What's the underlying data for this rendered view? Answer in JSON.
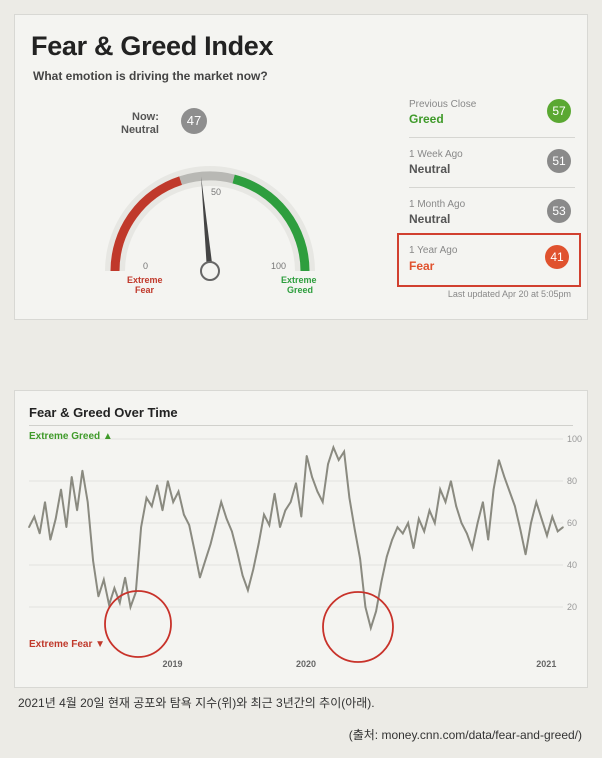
{
  "header": {
    "title": "Fear & Greed Index",
    "subtitle": "What emotion is driving the market now?"
  },
  "gauge": {
    "now_label": "Now:",
    "now_state": "Neutral",
    "now_value": "47",
    "needle_value": 47,
    "tick_0": "0",
    "tick_50": "50",
    "tick_100": "100",
    "left_label_1": "Extreme",
    "left_label_2": "Fear",
    "right_label_1": "Extreme",
    "right_label_2": "Greed",
    "colors": {
      "fear": "#c0392b",
      "greed": "#2e9e3e",
      "neutral": "#8e8e8e"
    }
  },
  "history": [
    {
      "label": "Previous Close",
      "state": "Greed",
      "value": "57",
      "color": "#5aa832",
      "text_color": "#3f9a2a"
    },
    {
      "label": "1 Week Ago",
      "state": "Neutral",
      "value": "51",
      "color": "#8a8a8a",
      "text_color": "#555555"
    },
    {
      "label": "1 Month Ago",
      "state": "Neutral",
      "value": "53",
      "color": "#8a8a8a",
      "text_color": "#555555"
    },
    {
      "label": "1 Year Ago",
      "state": "Fear",
      "value": "41",
      "color": "#e0522e",
      "text_color": "#e0522e"
    }
  ],
  "updated": "Last updated Apr 20 at 5:05pm",
  "over_time": {
    "title": "Fear & Greed Over Time",
    "extreme_greed_label": "Extreme Greed ▲",
    "extreme_fear_label": "Extreme Fear ▼",
    "greed_color": "#3f9a2a",
    "fear_color": "#c0392b"
  },
  "chart_data": {
    "type": "line",
    "title": "Fear & Greed Over Time",
    "y_ticks": [
      "20",
      "40",
      "60",
      "80",
      "100"
    ],
    "ylim": [
      0,
      100
    ],
    "x_labels": [
      "2019",
      "2020",
      "2021"
    ],
    "x_label_pos": [
      0.25,
      0.5,
      0.95
    ],
    "xlim": [
      0,
      1
    ],
    "line_color": "#8a8a80",
    "series": [
      {
        "x": [
          0.0,
          0.01,
          0.02,
          0.03,
          0.04,
          0.05,
          0.06,
          0.07,
          0.08,
          0.09,
          0.1,
          0.11,
          0.12,
          0.13,
          0.14,
          0.15,
          0.16,
          0.17,
          0.18,
          0.19,
          0.2,
          0.21,
          0.22,
          0.23,
          0.24,
          0.25,
          0.26,
          0.27,
          0.28,
          0.29,
          0.3,
          0.31,
          0.32,
          0.33,
          0.34,
          0.35,
          0.36,
          0.37,
          0.38,
          0.39,
          0.4,
          0.41,
          0.42,
          0.43,
          0.44,
          0.45,
          0.46,
          0.47,
          0.48,
          0.49,
          0.5,
          0.51,
          0.52,
          0.53,
          0.54,
          0.55,
          0.56,
          0.57,
          0.58,
          0.59,
          0.6,
          0.61,
          0.62,
          0.63,
          0.64,
          0.65,
          0.66,
          0.67,
          0.68,
          0.69,
          0.7,
          0.71,
          0.72,
          0.73,
          0.74,
          0.75,
          0.76,
          0.77,
          0.78,
          0.79,
          0.8,
          0.81,
          0.82,
          0.83,
          0.84,
          0.85,
          0.86,
          0.87,
          0.88,
          0.89,
          0.9,
          0.91,
          0.92,
          0.93,
          0.94,
          0.95,
          0.96,
          0.97,
          0.98,
          0.99,
          1.0
        ],
        "y": [
          58,
          63,
          55,
          70,
          52,
          62,
          76,
          58,
          82,
          66,
          85,
          70,
          42,
          25,
          33,
          21,
          29,
          22,
          34,
          20,
          27,
          58,
          72,
          68,
          78,
          66,
          80,
          70,
          75,
          64,
          59,
          47,
          34,
          42,
          50,
          60,
          70,
          62,
          56,
          46,
          35,
          28,
          38,
          50,
          64,
          59,
          74,
          58,
          66,
          70,
          79,
          63,
          92,
          82,
          75,
          70,
          88,
          96,
          90,
          94,
          72,
          57,
          43,
          20,
          10,
          18,
          32,
          44,
          52,
          58,
          55,
          60,
          48,
          62,
          56,
          66,
          60,
          76,
          70,
          80,
          68,
          60,
          55,
          48,
          60,
          70,
          52,
          76,
          90,
          82,
          75,
          68,
          57,
          45,
          60,
          70,
          62,
          54,
          63,
          56,
          58
        ]
      }
    ]
  },
  "caption": "2021년 4월 20일 현재 공포와 탐욕 지수(위)와 최근 3년간의 추이(아래).",
  "source": "(출처: money.cnn.com/data/fear-and-greed/)"
}
